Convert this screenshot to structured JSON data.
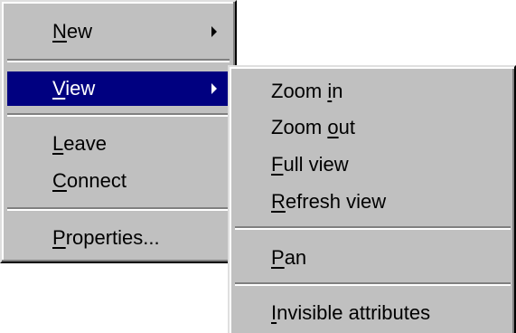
{
  "main_menu": {
    "new": {
      "mnemonic": "N",
      "rest": "ew"
    },
    "view": {
      "mnemonic": "V",
      "rest": "iew"
    },
    "leave": {
      "mnemonic": "L",
      "rest": "eave"
    },
    "connect": {
      "mnemonic": "C",
      "rest": "onnect"
    },
    "properties": {
      "mnemonic": "P",
      "rest": "roperties..."
    }
  },
  "view_submenu": {
    "zoom_in": {
      "before": "Zoom ",
      "mnemonic": "i",
      "after": "n"
    },
    "zoom_out": {
      "before": "Zoom ",
      "mnemonic": "o",
      "after": "ut"
    },
    "full_view": {
      "before": "",
      "mnemonic": "F",
      "after": "ull view"
    },
    "refresh_view": {
      "before": "",
      "mnemonic": "R",
      "after": "efresh view"
    },
    "pan": {
      "before": "",
      "mnemonic": "P",
      "after": "an"
    },
    "invisible_attributes": {
      "before": "",
      "mnemonic": "I",
      "after": "nvisible attributes"
    }
  },
  "colors": {
    "menu_bg": "#c0c0c0",
    "highlight_bg": "#000080",
    "highlight_text": "#ffffff"
  },
  "icons": {
    "submenu_arrow": "chevron-right-icon"
  }
}
